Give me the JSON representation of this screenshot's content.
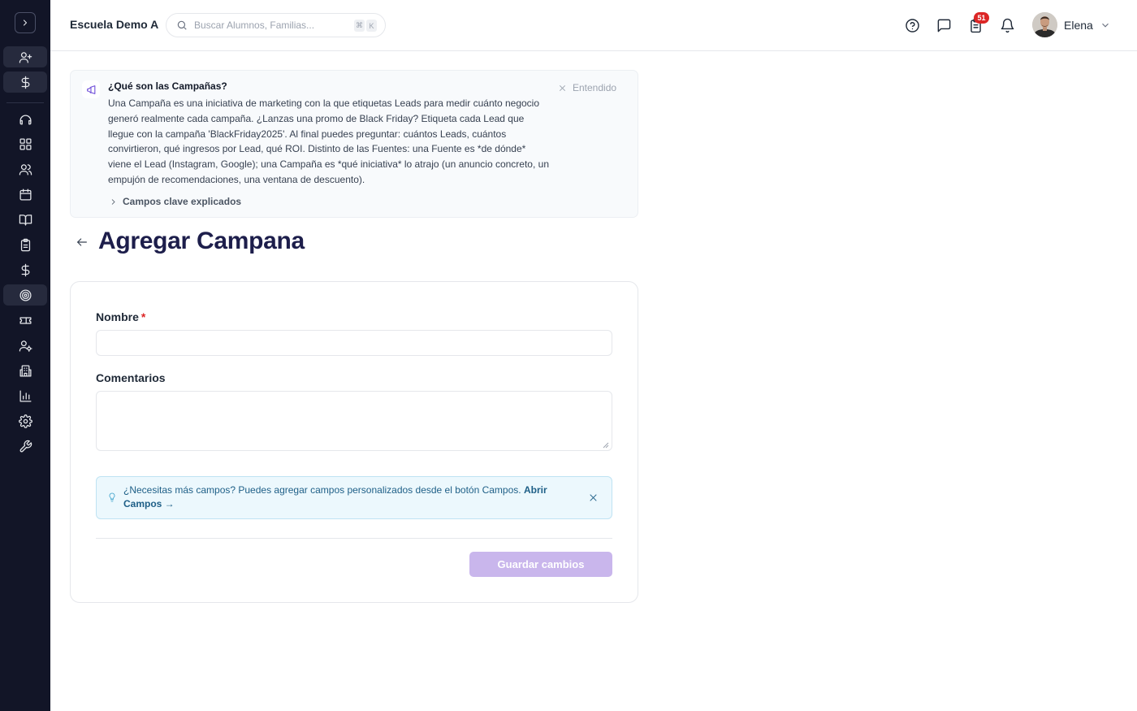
{
  "header": {
    "school_name": "Escuela Demo A",
    "search_placeholder": "Buscar Alumnos, Familias...",
    "search_kbd_1": "⌘",
    "search_kbd_2": "K",
    "tasks_badge": "51",
    "user_name": "Elena"
  },
  "sidebar": {
    "items": [
      "add-user",
      "dollar",
      "headset",
      "dashboard",
      "users",
      "calendar",
      "book",
      "clipboard",
      "dollar",
      "target",
      "ticket",
      "user-gear",
      "building",
      "bar-chart",
      "settings",
      "wrench"
    ],
    "active_item": "target"
  },
  "info_panel": {
    "title": "¿Qué son las Campañas?",
    "body": "Una Campaña es una iniciativa de marketing con la que etiquetas Leads para medir cuánto negocio generó realmente cada campaña. ¿Lanzas una promo de Black Friday? Etiqueta cada Lead que llegue con la campaña 'BlackFriday2025'. Al final puedes preguntar: cuántos Leads, cuántos convirtieron, qué ingresos por Lead, qué ROI. Distinto de las Fuentes: una Fuente es *de dónde* viene el Lead (Instagram, Google); una Campaña es *qué iniciativa* lo atrajo (un anuncio concreto, un empujón de recomendaciones, una ventana de descuento).",
    "dismiss_label": "Entendido",
    "expander_label": "Campos clave explicados"
  },
  "page": {
    "title": "Agregar Campana"
  },
  "form": {
    "name_label": "Nombre",
    "required_mark": "*",
    "name_value": "",
    "comments_label": "Comentarios",
    "comments_value": "",
    "tip_text": "¿Necesitas más campos? Puedes agregar campos personalizados desde el botón Campos.",
    "tip_link": "Abrir Campos →",
    "save_label": "Guardar cambios"
  },
  "colors": {
    "sidebar_bg": "#121527",
    "title": "#1d1e4b",
    "accent_disabled": "#c9b6ec",
    "tip_bg": "#ecf8fd",
    "badge": "#dc2626"
  }
}
